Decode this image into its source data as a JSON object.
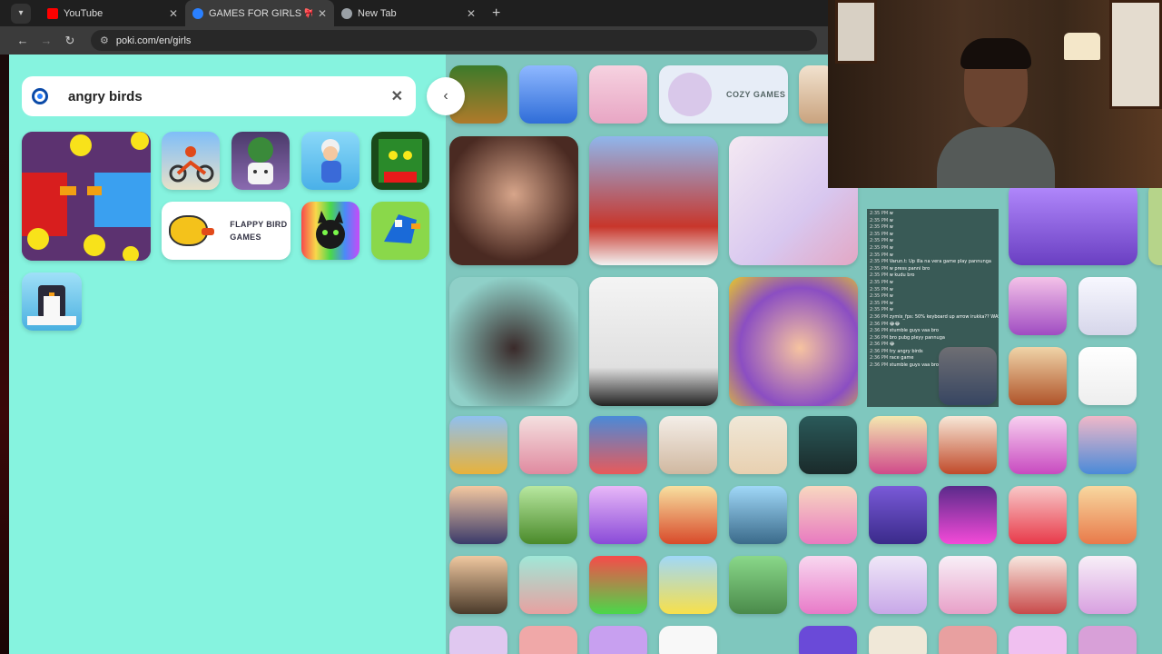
{
  "browser": {
    "tabs": [
      {
        "label": "YouTube",
        "active": false,
        "favicon_color": "#ff0000"
      },
      {
        "label": "GAMES FOR GIRLS 🎀 - Play O",
        "active": true,
        "favicon_color": "#2a80ff"
      },
      {
        "label": "New Tab",
        "active": false,
        "favicon_color": "#9aa0a6"
      }
    ],
    "url": "poki.com/en/girls"
  },
  "search": {
    "query": "angry birds",
    "clear_icon": "close-icon",
    "collapse_icon": "chevron-left-icon"
  },
  "results": {
    "flappy_label": "FLAPPY BIRD GAMES"
  },
  "grid": {
    "cozy_label": "COZY GAMES"
  },
  "chat": {
    "lines": [
      {
        "time": "2:35 PM",
        "msg": "w"
      },
      {
        "time": "2:35 PM",
        "msg": "w"
      },
      {
        "time": "2:35 PM",
        "msg": "w"
      },
      {
        "time": "2:35 PM",
        "msg": "w"
      },
      {
        "time": "2:35 PM",
        "msg": "w"
      },
      {
        "time": "2:35 PM",
        "msg": "w"
      },
      {
        "time": "2:35 PM",
        "msg": "w"
      },
      {
        "time": "2:35 PM",
        "msg": "Varun.t: Up illa na vera game play pannunga"
      },
      {
        "time": "2:35 PM",
        "msg": "w press panni bro"
      },
      {
        "time": "2:35 PM",
        "msg": "w kudu bro"
      },
      {
        "time": "2:35 PM",
        "msg": "w"
      },
      {
        "time": "2:35 PM",
        "msg": "w"
      },
      {
        "time": "2:35 PM",
        "msg": "w"
      },
      {
        "time": "2:35 PM",
        "msg": "w"
      },
      {
        "time": "2:35 PM",
        "msg": "w"
      },
      {
        "time": "2:36 PM",
        "msg": "zymix_fps: 50% keyboard up arrow irukka?? WASD mattum thaan"
      },
      {
        "time": "2:36 PM",
        "msg": "😂😂"
      },
      {
        "time": "2:36 PM",
        "msg": "stumble guys vaa bro"
      },
      {
        "time": "2:36 PM",
        "msg": "bro pubg pleyy pannuga"
      },
      {
        "time": "2:36 PM",
        "msg": "😂"
      },
      {
        "time": "2:36 PM",
        "msg": "try angry birds"
      },
      {
        "time": "2:36 PM",
        "msg": "race game"
      },
      {
        "time": "2:36 PM",
        "msg": "stumble guys vaa bro"
      }
    ]
  },
  "colors": {
    "panel_bg": "#86f3df",
    "page_bg": "#8fded3",
    "brand": "#0b4aa8"
  }
}
